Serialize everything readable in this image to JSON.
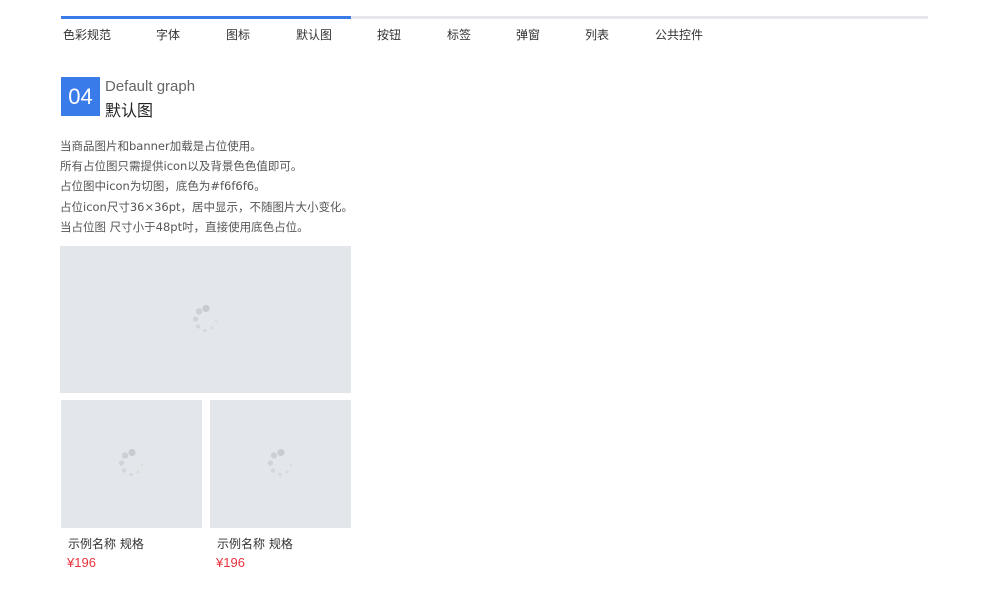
{
  "nav": {
    "items": [
      {
        "label": "色彩规范",
        "active": true
      },
      {
        "label": "字体",
        "active": true
      },
      {
        "label": "图标",
        "active": true
      },
      {
        "label": "默认图",
        "active": true
      },
      {
        "label": "按钮",
        "active": false
      },
      {
        "label": "标签",
        "active": false
      },
      {
        "label": "弹窗",
        "active": false
      },
      {
        "label": "列表",
        "active": false
      },
      {
        "label": "公共控件",
        "active": false
      }
    ],
    "accent_color": "#3a7bea",
    "track_color": "#e6e8eb"
  },
  "section": {
    "number": "04",
    "title_en": "Default graph",
    "title_cn": "默认图"
  },
  "description": [
    "当商品图片和banner加载是占位使用。",
    "所有占位图只需提供icon以及背景色色值即可。",
    "占位图中icon为切图，底色为#f6f6f6。",
    "占位icon尺寸36×36pt，居中显示，不随图片大小变化。",
    "当占位图 尺寸小于48pt吋，直接使用底色占位。"
  ],
  "placeholder": {
    "background_color": "#e3e6ea",
    "icon": "loading-spinner-icon"
  },
  "products": [
    {
      "name": "示例名称  规格",
      "price": "¥196"
    },
    {
      "name": "示例名称  规格",
      "price": "¥196"
    }
  ],
  "price_color": "#e8333c"
}
